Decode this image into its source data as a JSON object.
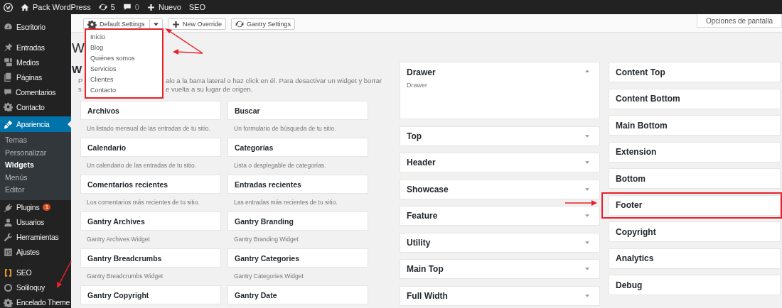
{
  "admin_bar": {
    "site": "Pack WordPress",
    "updates": "5",
    "comments": "0",
    "new": "Nuevo",
    "seo": "SEO"
  },
  "sidebar": {
    "groups": [
      [
        {
          "label": "Escritorio",
          "selected": false
        }
      ],
      [
        {
          "label": "Entradas",
          "selected": false
        },
        {
          "label": "Medios",
          "selected": false
        },
        {
          "label": "Páginas",
          "selected": false
        },
        {
          "label": "Comentarios",
          "selected": false
        },
        {
          "label": "Contacto",
          "selected": false
        },
        {
          "label": "Apariencia",
          "selected": true,
          "children": [
            {
              "label": "Temas",
              "selected": false
            },
            {
              "label": "Personalizar",
              "selected": false
            },
            {
              "label": "Widgets",
              "selected": true
            },
            {
              "label": "Menús",
              "selected": false
            },
            {
              "label": "Editor",
              "selected": false
            }
          ]
        },
        {
          "label": "Plugins",
          "selected": false,
          "badge": "1"
        },
        {
          "label": "Usuarios",
          "selected": false
        },
        {
          "label": "Herramientas",
          "selected": false
        },
        {
          "label": "Ajustes",
          "selected": false
        }
      ],
      [
        {
          "label": "SEO",
          "selected": false
        },
        {
          "label": "Soliloquy",
          "selected": false
        },
        {
          "label": "Encelado Theme",
          "selected": false
        }
      ]
    ]
  },
  "toolbar": {
    "default_settings": "Default Settings",
    "new_override": "New Override",
    "gantry_settings": "Gantry Settings",
    "screen_options": "Opciones de pantalla"
  },
  "dropdown": {
    "highlighted": true,
    "items": [
      "Inicio",
      "Blog",
      "Quiénes somos",
      "Servicios",
      "Clientes",
      "Contacto"
    ]
  },
  "heading": "W",
  "subheading": "W",
  "description_lines": [
    [
      "P",
      "alo a la barra lateral o haz click en él. Para desactivar un widget y borrar"
    ],
    [
      "s",
      "e vuelta a su lugar de origen."
    ]
  ],
  "widgets": [
    {
      "title": "Archivos",
      "description": "Un listado mensual de las entradas de tu sitio."
    },
    {
      "title": "Buscar",
      "description": "Un formulario de búsqueda de tu sitio."
    },
    {
      "title": "Calendario",
      "description": "Un calendario de las entradas de tu sitio."
    },
    {
      "title": "Categorías",
      "description": "Lista o desplegable de categorías."
    },
    {
      "title": "Comentarios recientes",
      "description": "Los comentarios más recientes de tu sitio."
    },
    {
      "title": "Entradas recientes",
      "description": "Las entradas más recientes de tu sitio."
    },
    {
      "title": "Gantry Archives",
      "description": "Gantry Archives Widget"
    },
    {
      "title": "Gantry Branding",
      "description": "Gantry Branding Widget"
    },
    {
      "title": "Gantry Breadcrumbs",
      "description": "Gantry Breadcrumbs Widget"
    },
    {
      "title": "Gantry Categories",
      "description": "Gantry Categories Widget"
    },
    {
      "title": "Gantry Copyright"
    },
    {
      "title": "Gantry Date"
    }
  ],
  "sidebar_areas": [
    {
      "title": "Drawer",
      "expanded": true,
      "description": "Drawer"
    },
    {
      "title": "Top",
      "expanded": false
    },
    {
      "title": "Header",
      "expanded": false
    },
    {
      "title": "Showcase",
      "expanded": false
    },
    {
      "title": "Feature",
      "expanded": false
    },
    {
      "title": "Utility",
      "expanded": false
    },
    {
      "title": "Main Top",
      "expanded": false
    },
    {
      "title": "Full Width",
      "expanded": false
    }
  ],
  "sidebar_areas_right": [
    {
      "title": "Content Top",
      "highlighted": false
    },
    {
      "title": "Content Bottom",
      "highlighted": false
    },
    {
      "title": "Main Bottom",
      "highlighted": false
    },
    {
      "title": "Extension",
      "highlighted": false
    },
    {
      "title": "Bottom",
      "highlighted": false
    },
    {
      "title": "Footer",
      "highlighted": true
    },
    {
      "title": "Copyright",
      "highlighted": false
    },
    {
      "title": "Analytics",
      "highlighted": false
    },
    {
      "title": "Debug",
      "highlighted": false
    }
  ]
}
